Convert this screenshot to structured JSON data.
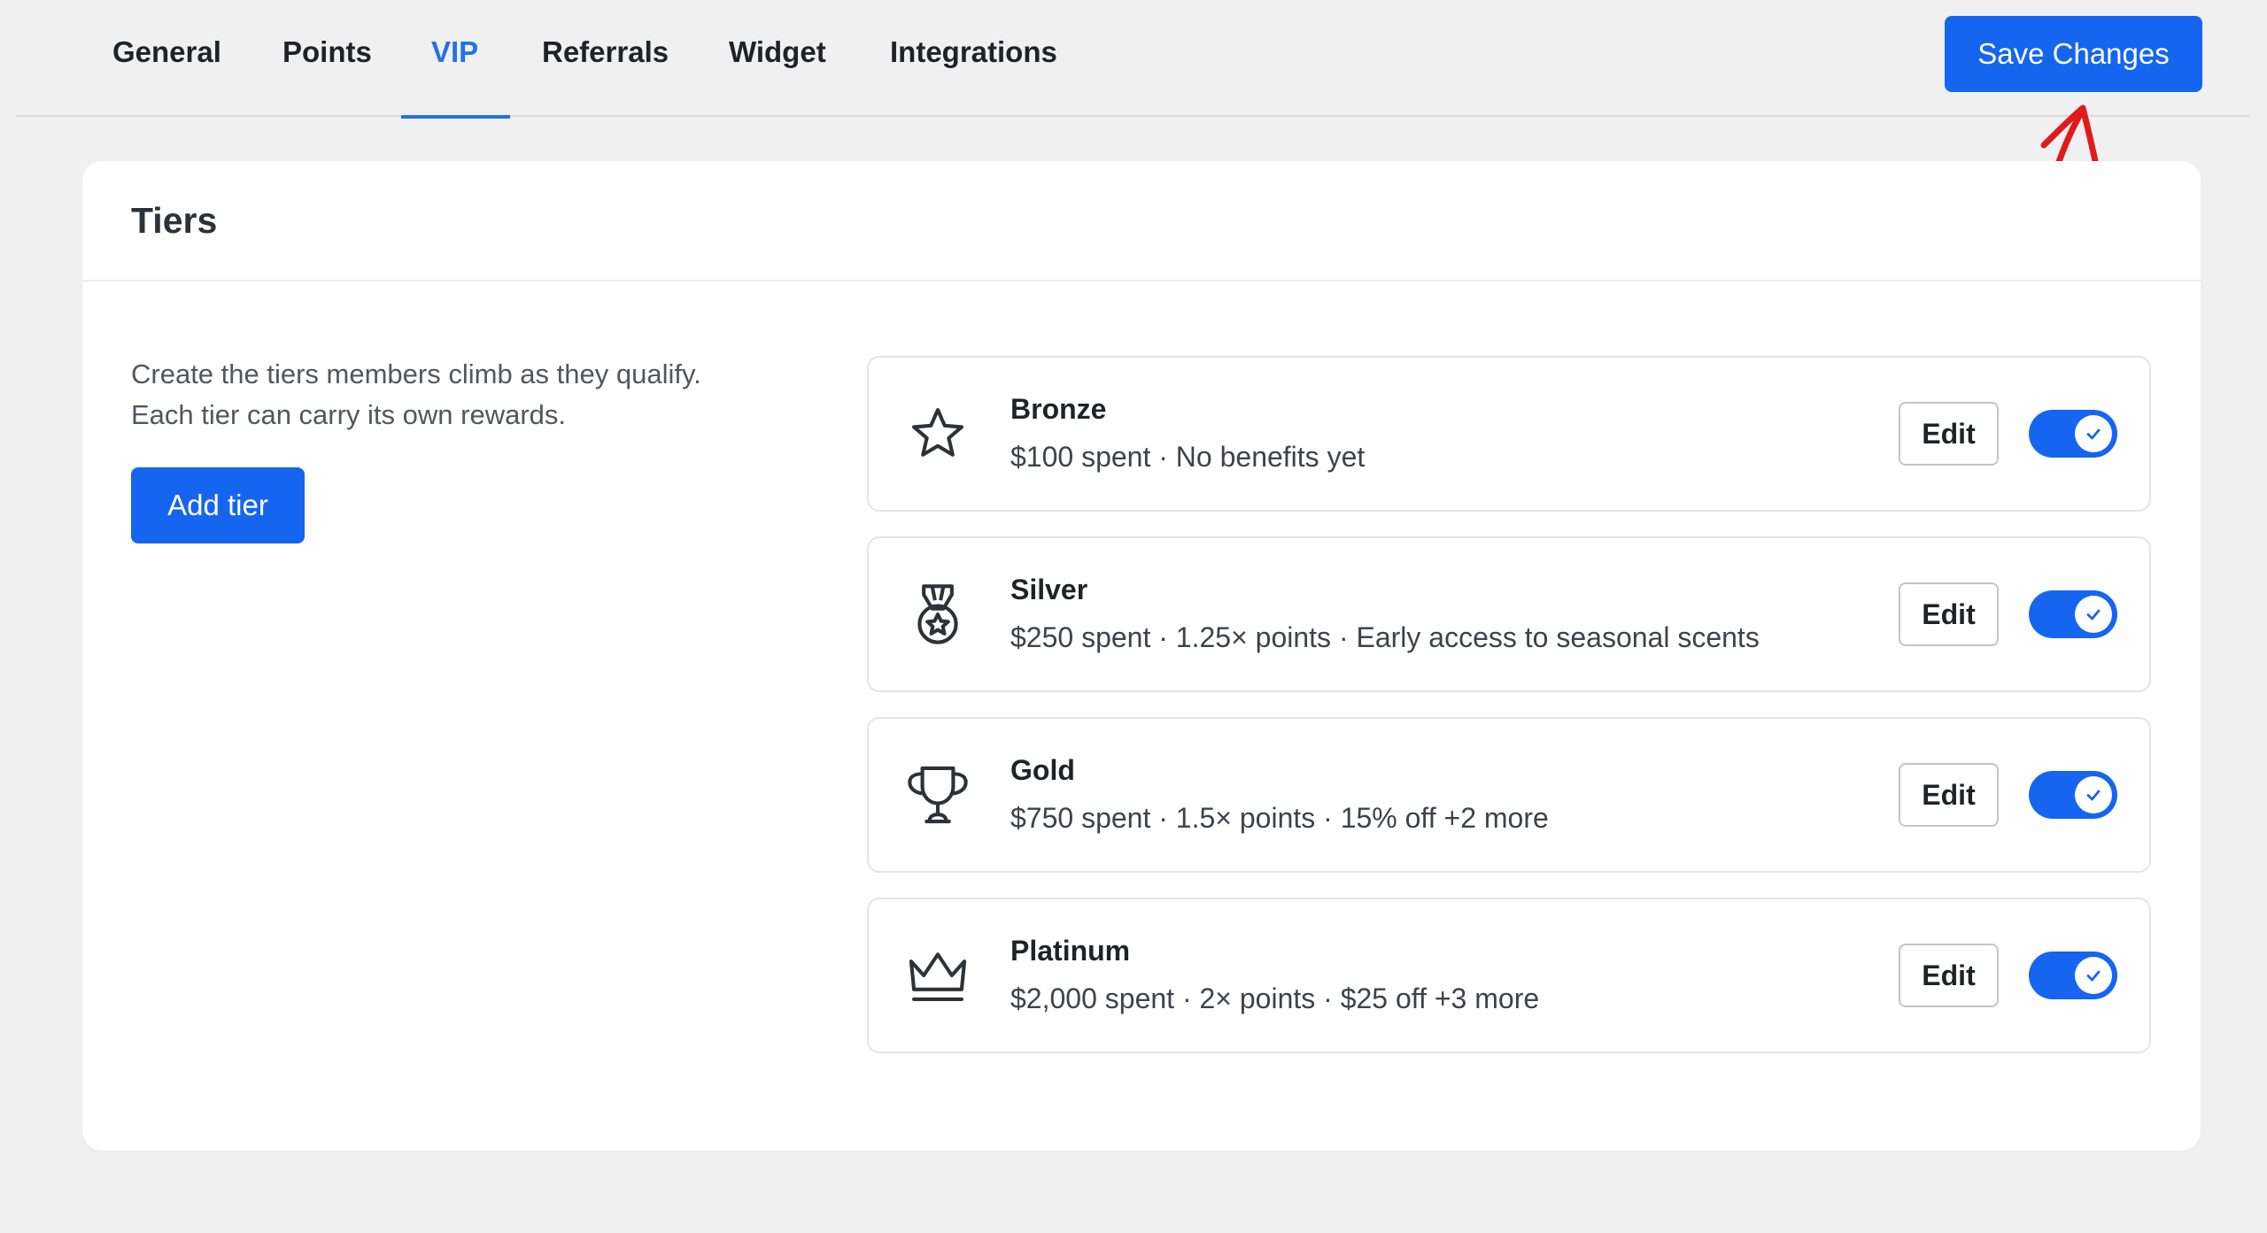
{
  "nav": {
    "tabs": [
      {
        "label": "General",
        "active": false
      },
      {
        "label": "Points",
        "active": false
      },
      {
        "label": "VIP",
        "active": true
      },
      {
        "label": "Referrals",
        "active": false
      },
      {
        "label": "Widget",
        "active": false
      },
      {
        "label": "Integrations",
        "active": false
      }
    ],
    "save_label": "Save Changes"
  },
  "colors": {
    "accent": "#1565f0",
    "active_tab": "#2271e8",
    "annotation": "#e01b1b"
  },
  "tiers_card": {
    "title": "Tiers",
    "description_line1": "Create the tiers members climb as they qualify.",
    "description_line2": "Each tier can carry its own rewards.",
    "add_label": "Add tier",
    "tiers": [
      {
        "name": "Bronze",
        "meta": "$100 spent · No benefits yet",
        "icon": "star-icon",
        "enabled": true,
        "edit_label": "Edit"
      },
      {
        "name": "Silver",
        "meta": "$250 spent · 1.25× points · Early access to seasonal scents",
        "icon": "medal-icon",
        "enabled": true,
        "edit_label": "Edit"
      },
      {
        "name": "Gold",
        "meta": "$750 spent · 1.5× points · 15% off +2 more",
        "icon": "trophy-icon",
        "enabled": true,
        "edit_label": "Edit"
      },
      {
        "name": "Platinum",
        "meta": "$2,000 spent · 2× points · $25 off +3 more",
        "icon": "crown-icon",
        "enabled": true,
        "edit_label": "Edit"
      }
    ]
  }
}
